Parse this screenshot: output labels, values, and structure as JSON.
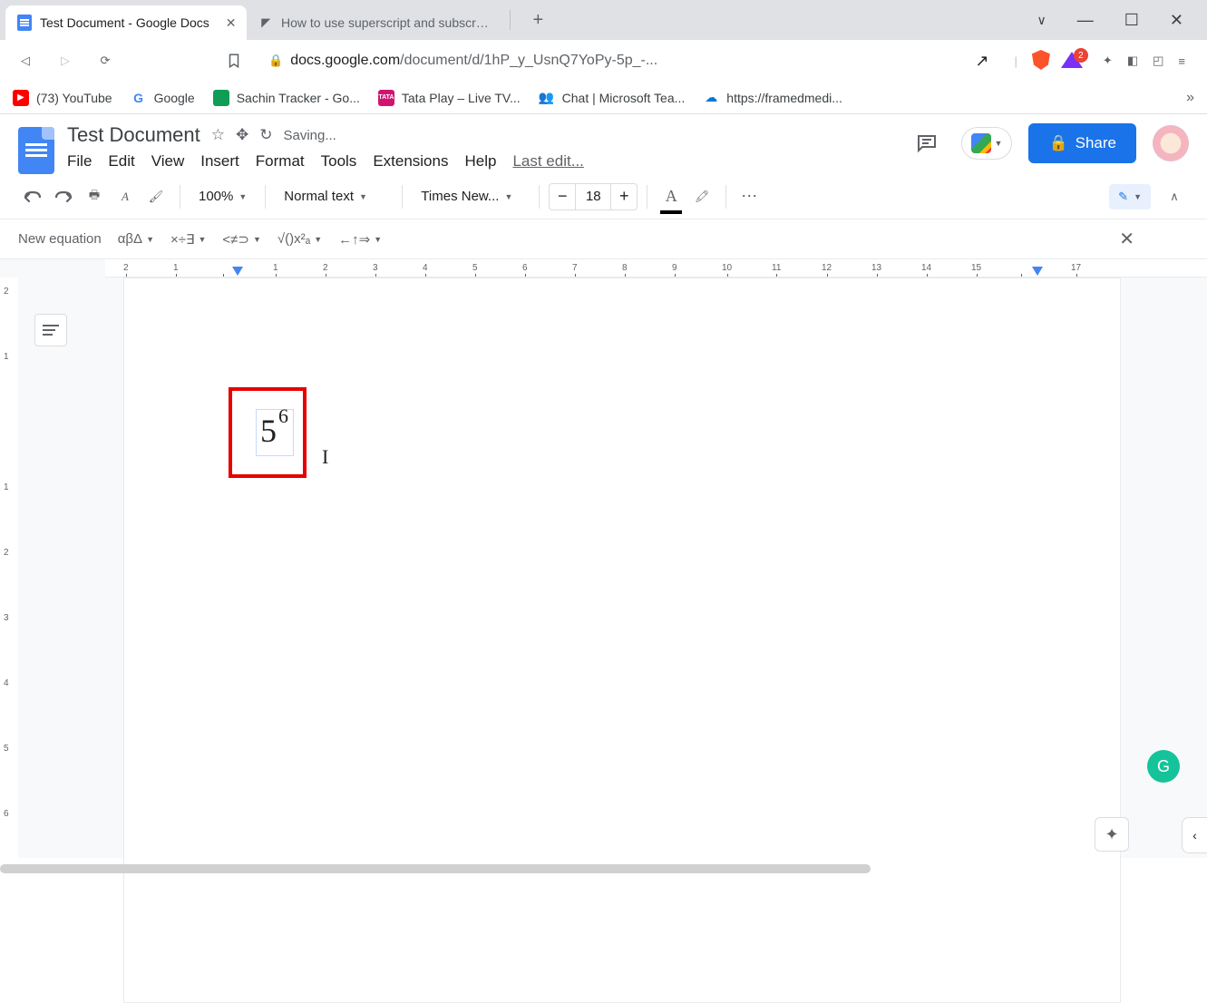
{
  "tabs": {
    "active": "Test Document - Google Docs",
    "inactive": "How to use superscript and subscript i"
  },
  "url": {
    "host": "docs.google.com",
    "path": "/document/d/1hP_y_UsnQ7YoPy-5p_-..."
  },
  "badge_count": "2",
  "bookmarks": {
    "yt": "(73) YouTube",
    "google": "Google",
    "sheets": "Sachin Tracker - Go...",
    "tata": "Tata Play – Live TV...",
    "teams": "Chat | Microsoft Tea...",
    "framed": "https://framedmedi..."
  },
  "doc": {
    "title": "Test Document",
    "saving": "Saving...",
    "last_edit": "Last edit..."
  },
  "menu": {
    "file": "File",
    "edit": "Edit",
    "view": "View",
    "insert": "Insert",
    "format": "Format",
    "tools": "Tools",
    "ext": "Extensions",
    "help": "Help"
  },
  "share": "Share",
  "toolbar": {
    "zoom": "100%",
    "style": "Normal text",
    "font": "Times New...",
    "size": "18"
  },
  "eqbar": {
    "label": "New equation",
    "g1": "αβΔ",
    "g2": "×÷∃",
    "g3": "<≠⊃",
    "g4": "√()x²ₐ",
    "g5": "←↑⇒"
  },
  "ruler_ticks": [
    "2",
    "1",
    "",
    "1",
    "2",
    "3",
    "4",
    "5",
    "6",
    "7",
    "8",
    "9",
    "10",
    "11",
    "12",
    "13",
    "14",
    "15",
    "",
    "17"
  ],
  "content": {
    "base": "5",
    "exp": "6",
    "cursor": "I"
  },
  "grammarly": "G"
}
